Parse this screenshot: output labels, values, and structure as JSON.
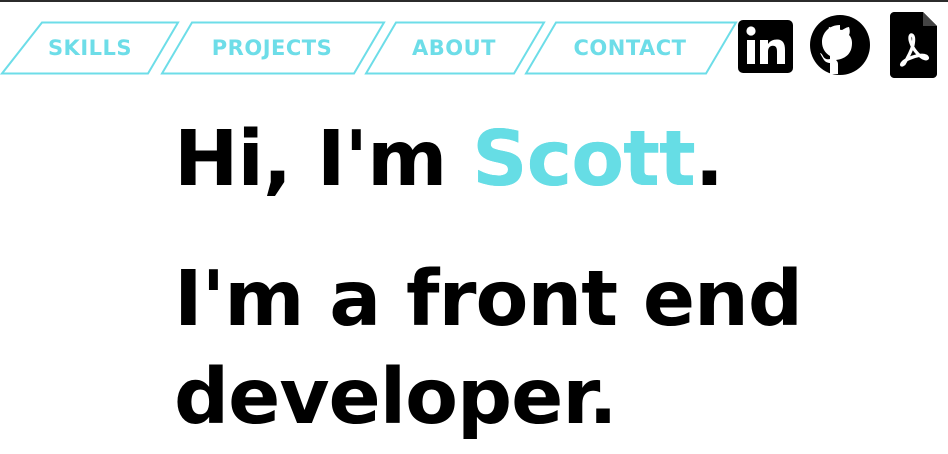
{
  "nav": {
    "items": [
      {
        "label": "SKILLS"
      },
      {
        "label": "PROJECTS"
      },
      {
        "label": "ABOUT"
      },
      {
        "label": "CONTACT"
      }
    ]
  },
  "social": {
    "linkedin_icon": "linkedin-icon",
    "github_icon": "github-icon",
    "resume_icon": "pdf-icon"
  },
  "hero": {
    "greeting_prefix": "Hi, I'm ",
    "name": "Scott",
    "greeting_suffix": ".",
    "role_line_1": "I'm a front end",
    "role_line_2": "developer."
  },
  "colors": {
    "accent": "#6ddde8",
    "text": "#000000",
    "background": "#ffffff"
  }
}
